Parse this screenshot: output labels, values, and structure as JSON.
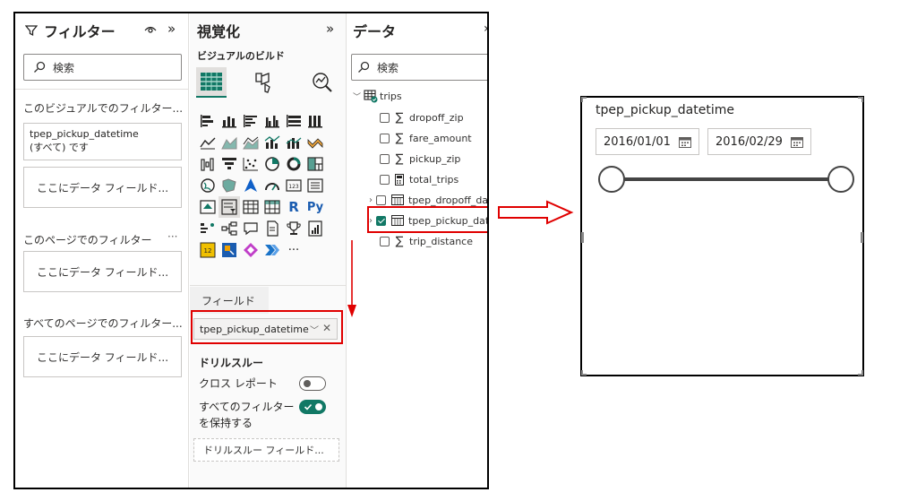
{
  "filters_pane": {
    "title": "フィルター",
    "search_placeholder": "検索",
    "section_visual": "このビジュアルでのフィルター...",
    "field_card": {
      "name": "tpep_pickup_datetime",
      "value": "(すべて) です"
    },
    "drop_label": "ここにデータ フィールド...",
    "section_page": "このページでのフィルター",
    "section_all": "すべてのページでのフィルター..."
  },
  "viz_pane": {
    "title": "視覚化",
    "build_label": "ビジュアルのビルド",
    "fields_label": "フィールド",
    "field_chip": "tpep_pickup_datetime",
    "drill_title": "ドリルスルー",
    "cross_report": "クロス レポート",
    "keep_filters_line1": "すべてのフィルター",
    "keep_filters_line2": "を保持する",
    "drill_drop": "ドリルスルー フィールド...",
    "more": "···",
    "r_icon": "R",
    "py_icon": "Py"
  },
  "data_pane": {
    "title": "データ",
    "search_placeholder": "検索",
    "table_name": "trips",
    "fields": [
      {
        "name": "dropoff_zip",
        "kind": "sigma"
      },
      {
        "name": "fare_amount",
        "kind": "sigma"
      },
      {
        "name": "pickup_zip",
        "kind": "sigma"
      },
      {
        "name": "total_trips",
        "kind": "calc"
      },
      {
        "name": "tpep_dropoff_da",
        "kind": "table"
      },
      {
        "name": "tpep_pickup_dat",
        "kind": "table"
      },
      {
        "name": "trip_distance",
        "kind": "sigma"
      }
    ]
  },
  "slicer": {
    "title": "tpep_pickup_datetime",
    "start_date": "2016/01/01",
    "end_date": "2016/02/29"
  },
  "colors": {
    "accent": "#117865",
    "highlight": "#e00000"
  }
}
